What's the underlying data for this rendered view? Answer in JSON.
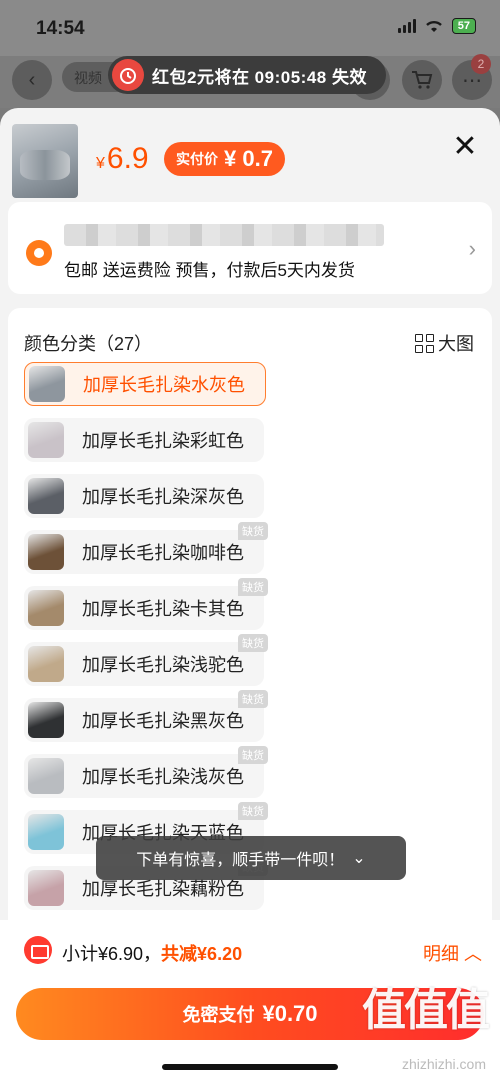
{
  "status_bar": {
    "time": "14:54",
    "battery": "57"
  },
  "background": {
    "video_tab": "视频",
    "cart_badge": "2"
  },
  "promo": {
    "text": "红包2元将在 09:05:48 失效"
  },
  "product": {
    "price_symbol": "¥",
    "price": "6.9",
    "real_price_label": "实付价",
    "real_price_value": "¥ 0.7"
  },
  "address": {
    "shipping_info": "包邮 送运费险 预售，付款后5天内发货"
  },
  "options": {
    "title": "颜色分类（27）",
    "big_view_label": "大图",
    "out_of_stock_label": "缺货",
    "items": [
      {
        "label": "加厚长毛扎染水灰色",
        "selected": true,
        "out_of_stock": false,
        "color": "#8e969e"
      },
      {
        "label": "加厚长毛扎染彩虹色",
        "selected": false,
        "out_of_stock": false,
        "color": "#c9c2c8"
      },
      {
        "label": "加厚长毛扎染深灰色",
        "selected": false,
        "out_of_stock": false,
        "color": "#5b5f66"
      },
      {
        "label": "加厚长毛扎染咖啡色",
        "selected": false,
        "out_of_stock": true,
        "color": "#6d5138"
      },
      {
        "label": "加厚长毛扎染卡其色",
        "selected": false,
        "out_of_stock": true,
        "color": "#a48a6b"
      },
      {
        "label": "加厚长毛扎染浅驼色",
        "selected": false,
        "out_of_stock": true,
        "color": "#c0a98a"
      },
      {
        "label": "加厚长毛扎染黑灰色",
        "selected": false,
        "out_of_stock": true,
        "color": "#2f3133"
      },
      {
        "label": "加厚长毛扎染浅灰色",
        "selected": false,
        "out_of_stock": true,
        "color": "#b9bcc0"
      },
      {
        "label": "加厚长毛扎染天蓝色",
        "selected": false,
        "out_of_stock": true,
        "color": "#7ec3d8"
      },
      {
        "label": "加厚长毛扎染藕粉色",
        "selected": false,
        "out_of_stock": true,
        "color": "#c6a2a8"
      }
    ]
  },
  "toast": {
    "text": "下单有惊喜，顺手带一件呗！",
    "chevron": "⌄"
  },
  "footer": {
    "subtotal_text": "小计¥6.90，",
    "reduce_text": "共减¥6.20",
    "detail_label": "明细",
    "pay_label": "免密支付",
    "pay_value": "¥0.70",
    "watermark": "值值值",
    "watermark_sub": "zhizhizhi.com"
  }
}
